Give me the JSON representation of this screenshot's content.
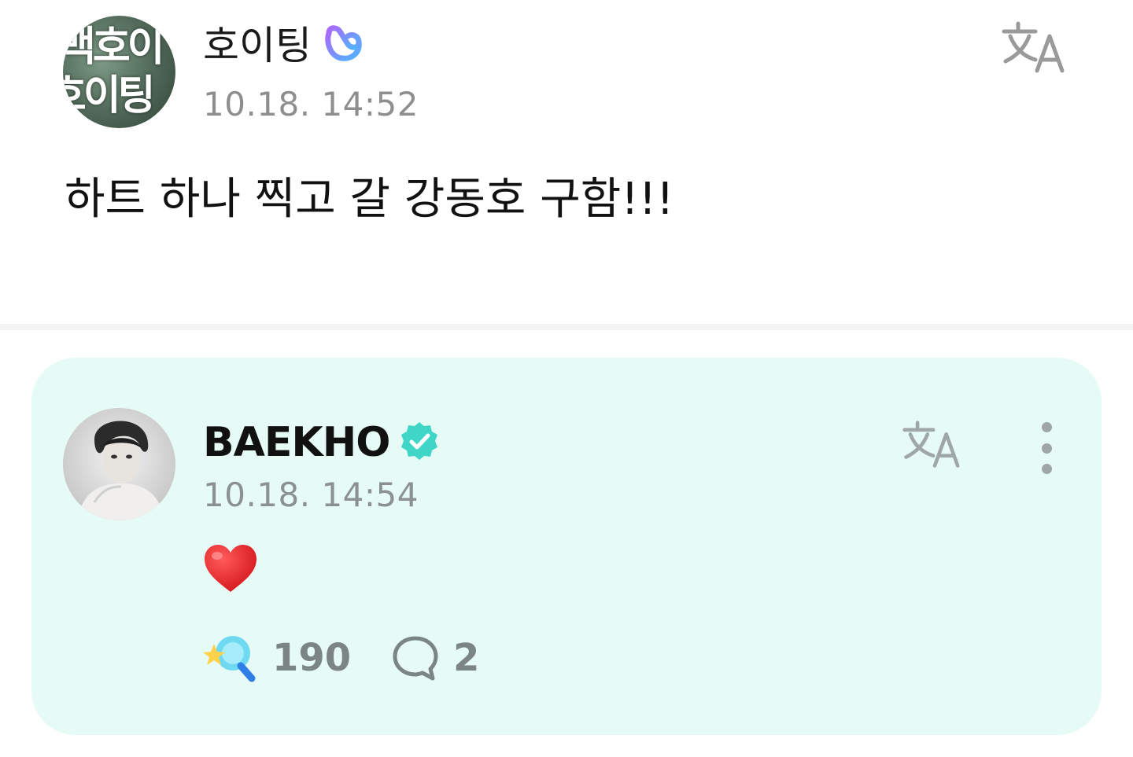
{
  "post": {
    "author": "호이팅",
    "avatar_text": [
      "백호이",
      "호이팅"
    ],
    "timestamp": "10.18. 14:52",
    "body": "하트 하나 찍고 갈 강동호 구함!!!",
    "badge_icon": "membership-badge-icon",
    "translate_icon": "translate-icon"
  },
  "reply": {
    "author": "BAEKHO",
    "timestamp": "10.18. 14:54",
    "badge_icon": "verified-badge-icon",
    "translate_icon": "translate-icon",
    "content_emoji": "red-heart-icon",
    "like_count": "190",
    "comment_count": "2"
  },
  "colors": {
    "card_background": "#e7fbf6",
    "verified_badge": "#3fd6c8",
    "heart": "#e0191e",
    "muted_text": "#8e8e8e"
  }
}
